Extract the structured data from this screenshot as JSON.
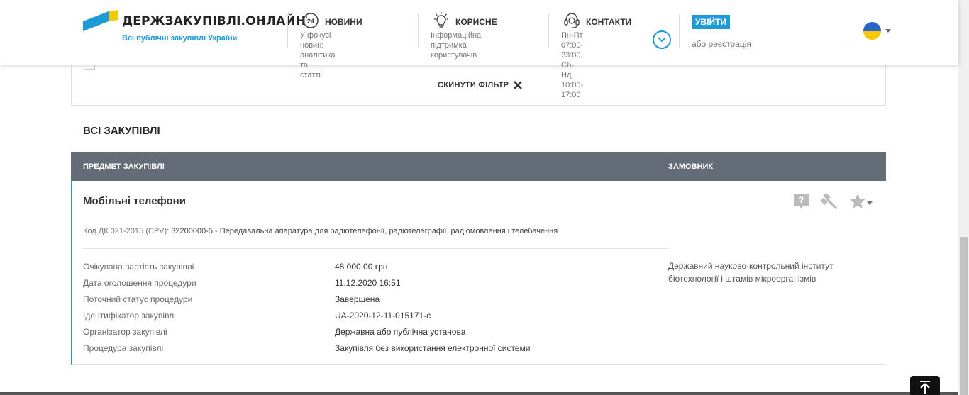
{
  "header": {
    "logo_title": "ДЕРЖЗАКУПІВЛІ.ОНЛАЙН",
    "logo_subtitle": "Всі публічні закупівлі України",
    "nav": [
      {
        "title": "НОВИНИ",
        "desc_line1": "У фокусі новин: аналітика та",
        "desc_line2": "статті",
        "icon": "news-24-icon"
      },
      {
        "title": "КОРИСНЕ",
        "desc_line1": "Інформаційна підтримка",
        "desc_line2": "користувачів",
        "icon": "lightbulb-icon"
      },
      {
        "title": "КОНТАКТИ",
        "desc_line1": "Пн-Пт 07:00-23:00,",
        "desc_line2": "Сб-Нд 10:00-17:00",
        "icon": "headset-icon"
      }
    ],
    "login_label": "УВІЙТИ",
    "register_text": "або реєстрація",
    "accent_color": "#1d9bd7"
  },
  "filter": {
    "reset_label": "СКИНУТИ ФІЛЬТР"
  },
  "section_title": "ВСІ ЗАКУПІВЛІ",
  "table": {
    "columns": [
      "ПРЕДМЕТ ЗАКУПІВЛІ",
      "ЗАМОВНИК"
    ],
    "rows": [
      {
        "title": "Мобільні телефони",
        "cpv_label": "Код ДК 021-2015 (CPV):",
        "cpv_value": "32200000-5 - Передавальна апаратура для радіотелефонії, радіотелеграфії, радіомовлення і телебачення",
        "fields": [
          {
            "label": "Очікувана вартість закупівлі",
            "value": "48 000.00 грн"
          },
          {
            "label": "Дата оголошення процедури",
            "value": "11.12.2020 16:51"
          },
          {
            "label": "Поточний статус процедури",
            "value": "Завершена"
          },
          {
            "label": "Ідентифікатор закупівлі",
            "value": "UA-2020-12-11-015171-c"
          },
          {
            "label": "Організатор закупівлі",
            "value": "Державна або публічна установа"
          },
          {
            "label": "Процедура закупівлі",
            "value": "Закупівля без використання електронної системи"
          }
        ],
        "customer_line1": "Державний науково-контрольний інститут",
        "customer_line2": "біотехнології і штамів мікроорганізмів"
      }
    ]
  }
}
